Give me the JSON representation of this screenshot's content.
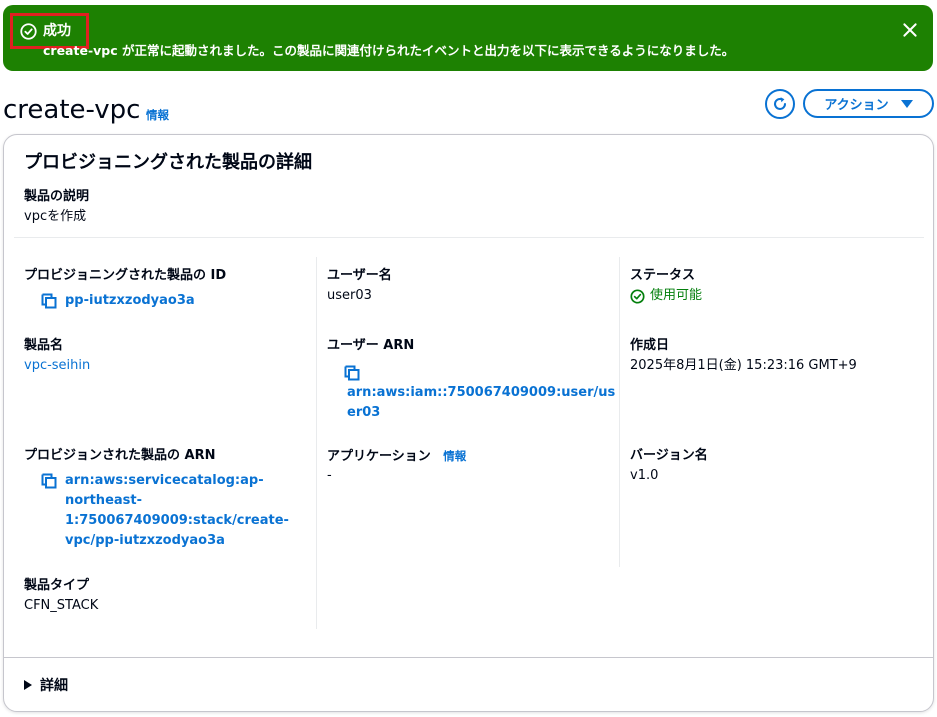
{
  "flash": {
    "title": "成功",
    "message": "create-vpc が正常に起動されました。この製品に関連付けられたイベントと出力を以下に表示できるようになりました。"
  },
  "header": {
    "title": "create-vpc",
    "info": "情報",
    "actions_label": "アクション"
  },
  "panel": {
    "title": "プロビジョニングされた製品の詳細",
    "description_label": "製品の説明",
    "description_value": "vpcを作成",
    "col1": {
      "pp_id_label": "プロビジョニングされた製品の ID",
      "pp_id_value": "pp-iutzxzodyao3a",
      "product_name_label": "製品名",
      "product_name_value": "vpc-seihin",
      "arn_label": "プロビジョンされた製品の ARN",
      "arn_lines": [
        "arn:aws:servicecatalog:ap-",
        "northeast-",
        "1:750067409009:stack/create-",
        "vpc/pp-iutzxzodyao3a"
      ],
      "product_type_label": "製品タイプ",
      "product_type_value": "CFN_STACK"
    },
    "col2": {
      "user_label": "ユーザー名",
      "user_value": "user03",
      "user_arn_label": "ユーザー ARN",
      "user_arn_lines": [
        "arn:aws:iam::750067409009:user/us",
        "er03"
      ],
      "application_label": "アプリケーション",
      "application_info": "情報",
      "application_value": "-"
    },
    "col3": {
      "status_label": "ステータス",
      "status_value": "使用可能",
      "created_label": "作成日",
      "created_value": "2025年8月1日(金) 15:23:16 GMT+9",
      "version_label": "バージョン名",
      "version_value": "v1.0"
    },
    "details_label": "詳細"
  }
}
